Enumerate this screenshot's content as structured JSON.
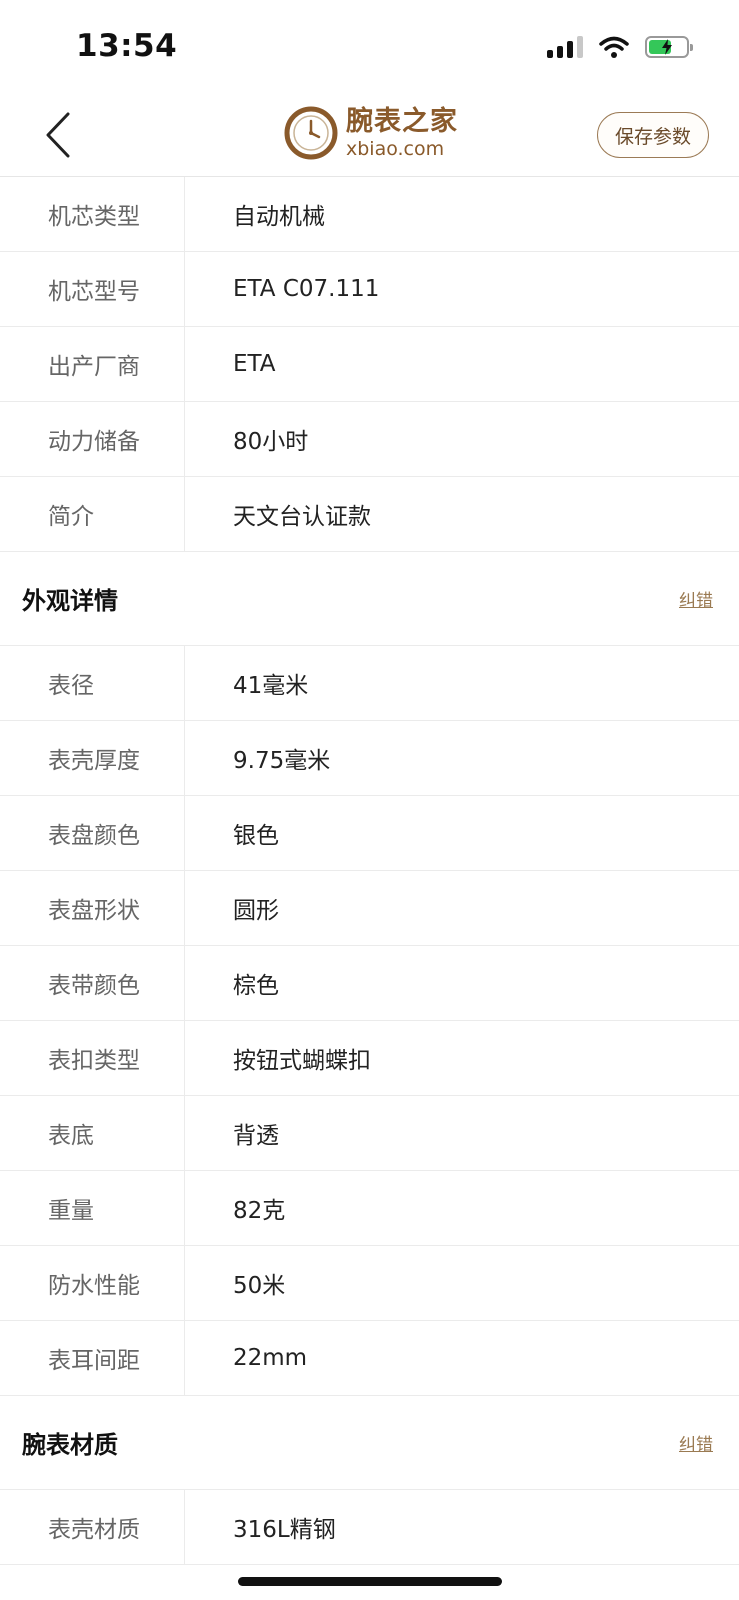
{
  "status_bar": {
    "time": "13:54",
    "battery_level": 0.6
  },
  "header": {
    "logo_cn": "腕表之家",
    "logo_en": "xbiao.com",
    "save_label": "保存参数"
  },
  "movement_rows": [
    {
      "label": "机芯类型",
      "value": "自动机械"
    },
    {
      "label": "机芯型号",
      "value": "ETA C07.111"
    },
    {
      "label": "出产厂商",
      "value": "ETA"
    },
    {
      "label": "动力储备",
      "value": "80小时"
    },
    {
      "label": "简介",
      "value": "天文台认证款"
    }
  ],
  "appearance": {
    "title": "外观详情",
    "correct_label": "纠错",
    "rows": [
      {
        "label": "表径",
        "value": "41毫米"
      },
      {
        "label": "表壳厚度",
        "value": "9.75毫米"
      },
      {
        "label": "表盘颜色",
        "value": "银色"
      },
      {
        "label": "表盘形状",
        "value": "圆形"
      },
      {
        "label": "表带颜色",
        "value": "棕色"
      },
      {
        "label": "表扣类型",
        "value": "按钮式蝴蝶扣"
      },
      {
        "label": "表底",
        "value": "背透"
      },
      {
        "label": "重量",
        "value": "82克"
      },
      {
        "label": "防水性能",
        "value": "50米"
      },
      {
        "label": "表耳间距",
        "value": "22mm"
      }
    ]
  },
  "material": {
    "title": "腕表材质",
    "correct_label": "纠错",
    "rows": [
      {
        "label": "表壳材质",
        "value": "316L精钢"
      }
    ]
  }
}
